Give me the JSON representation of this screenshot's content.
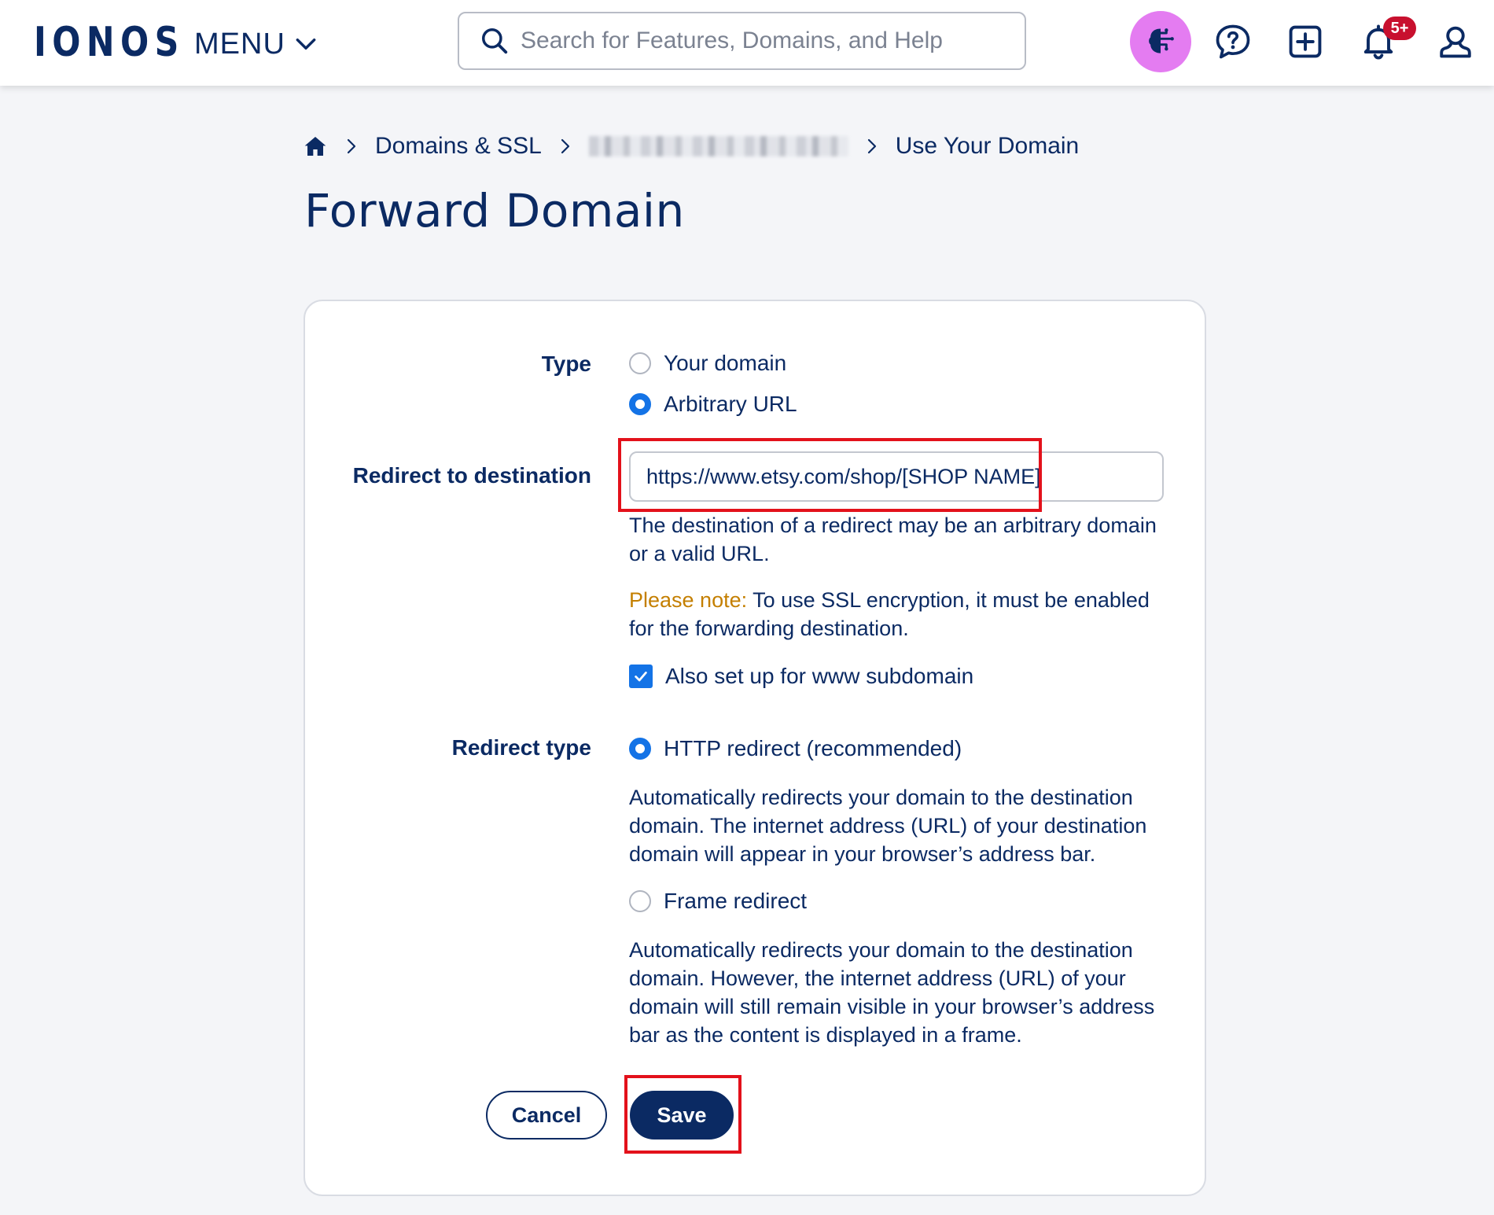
{
  "header": {
    "logo": "IONOS",
    "menu_label": "MENU",
    "search_placeholder": "Search for Features, Domains, and Help",
    "notifications_badge": "5+"
  },
  "breadcrumb": {
    "items": [
      "Domains & SSL",
      "Use Your Domain"
    ]
  },
  "page": {
    "title": "Forward Domain"
  },
  "form": {
    "type": {
      "label": "Type",
      "options": [
        "Your domain",
        "Arbitrary URL"
      ],
      "selected": "Arbitrary URL"
    },
    "destination": {
      "label": "Redirect to destination",
      "value": "https://www.etsy.com/shop/[SHOP NAME]",
      "hint": "The destination of a redirect may be an arbitrary domain or a valid URL.",
      "note_label": "Please note:",
      "note_text": " To use SSL encryption, it must be enabled for the forwarding destination.",
      "www_checkbox_label": "Also set up for www subdomain",
      "www_checked": true
    },
    "redirect_type": {
      "label": "Redirect type",
      "http_label": "HTTP redirect (recommended)",
      "http_description": "Automatically redirects your domain to the destination domain. The internet address (URL) of your destination domain will appear in your browser’s address bar.",
      "frame_label": "Frame redirect",
      "frame_description": "Automatically redirects your domain to the destination domain. However, the internet address (URL) of your domain will still remain visible in your browser’s address bar as the content is displayed in a frame.",
      "selected": "HTTP redirect (recommended)"
    },
    "cancel_label": "Cancel",
    "save_label": "Save"
  },
  "colors": {
    "brand": "#0b2a63",
    "accent": "#1473e6",
    "note": "#c47f00",
    "highlight": "#e3111b",
    "ai_button": "#e47cf1",
    "badge": "#c8102e"
  }
}
